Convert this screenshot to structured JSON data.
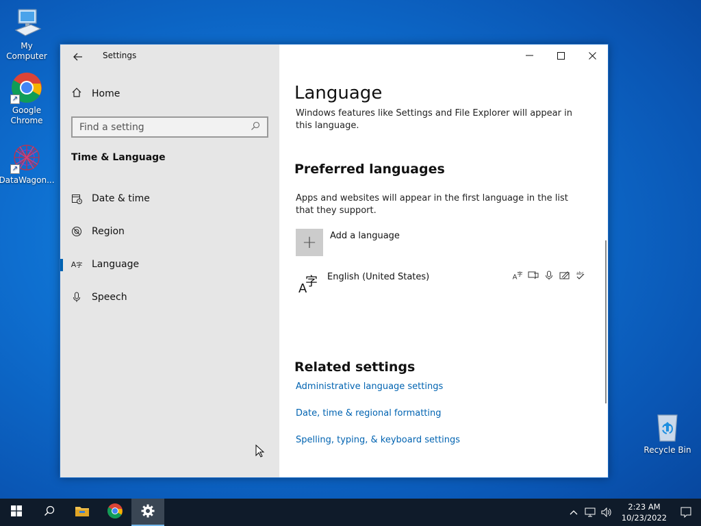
{
  "desktop": {
    "icons": [
      {
        "label": "My Computer"
      },
      {
        "label": "Google Chrome"
      },
      {
        "label": "DataWagon..."
      }
    ],
    "recycle_bin": "Recycle Bin"
  },
  "window": {
    "title": "Settings",
    "controls": {
      "minimize": "—",
      "maximize": "☐",
      "close": "✕"
    }
  },
  "sidebar": {
    "home_label": "Home",
    "search_placeholder": "Find a setting",
    "section": "Time & Language",
    "items": [
      {
        "label": "Date & time",
        "icon": "calendar-clock-icon"
      },
      {
        "label": "Region",
        "icon": "globe-icon"
      },
      {
        "label": "Language",
        "icon": "language-icon",
        "active": true
      },
      {
        "label": "Speech",
        "icon": "microphone-icon"
      }
    ]
  },
  "main": {
    "title": "Language",
    "description": "Windows features like Settings and File Explorer will appear in this language.",
    "preferred_title": "Preferred languages",
    "preferred_desc": "Apps and websites will appear in the first language in the list that they support.",
    "add_language": "Add a language",
    "languages": [
      {
        "name": "English (United States)"
      }
    ],
    "related_title": "Related settings",
    "links": [
      "Administrative language settings",
      "Date, time & regional formatting",
      "Spelling, typing, & keyboard settings"
    ]
  },
  "taskbar": {
    "time": "2:23 AM",
    "date": "10/23/2022"
  },
  "colors": {
    "accent": "#0063b1",
    "taskbar": "#0f1b2a",
    "sidebar": "#e6e6e6"
  }
}
